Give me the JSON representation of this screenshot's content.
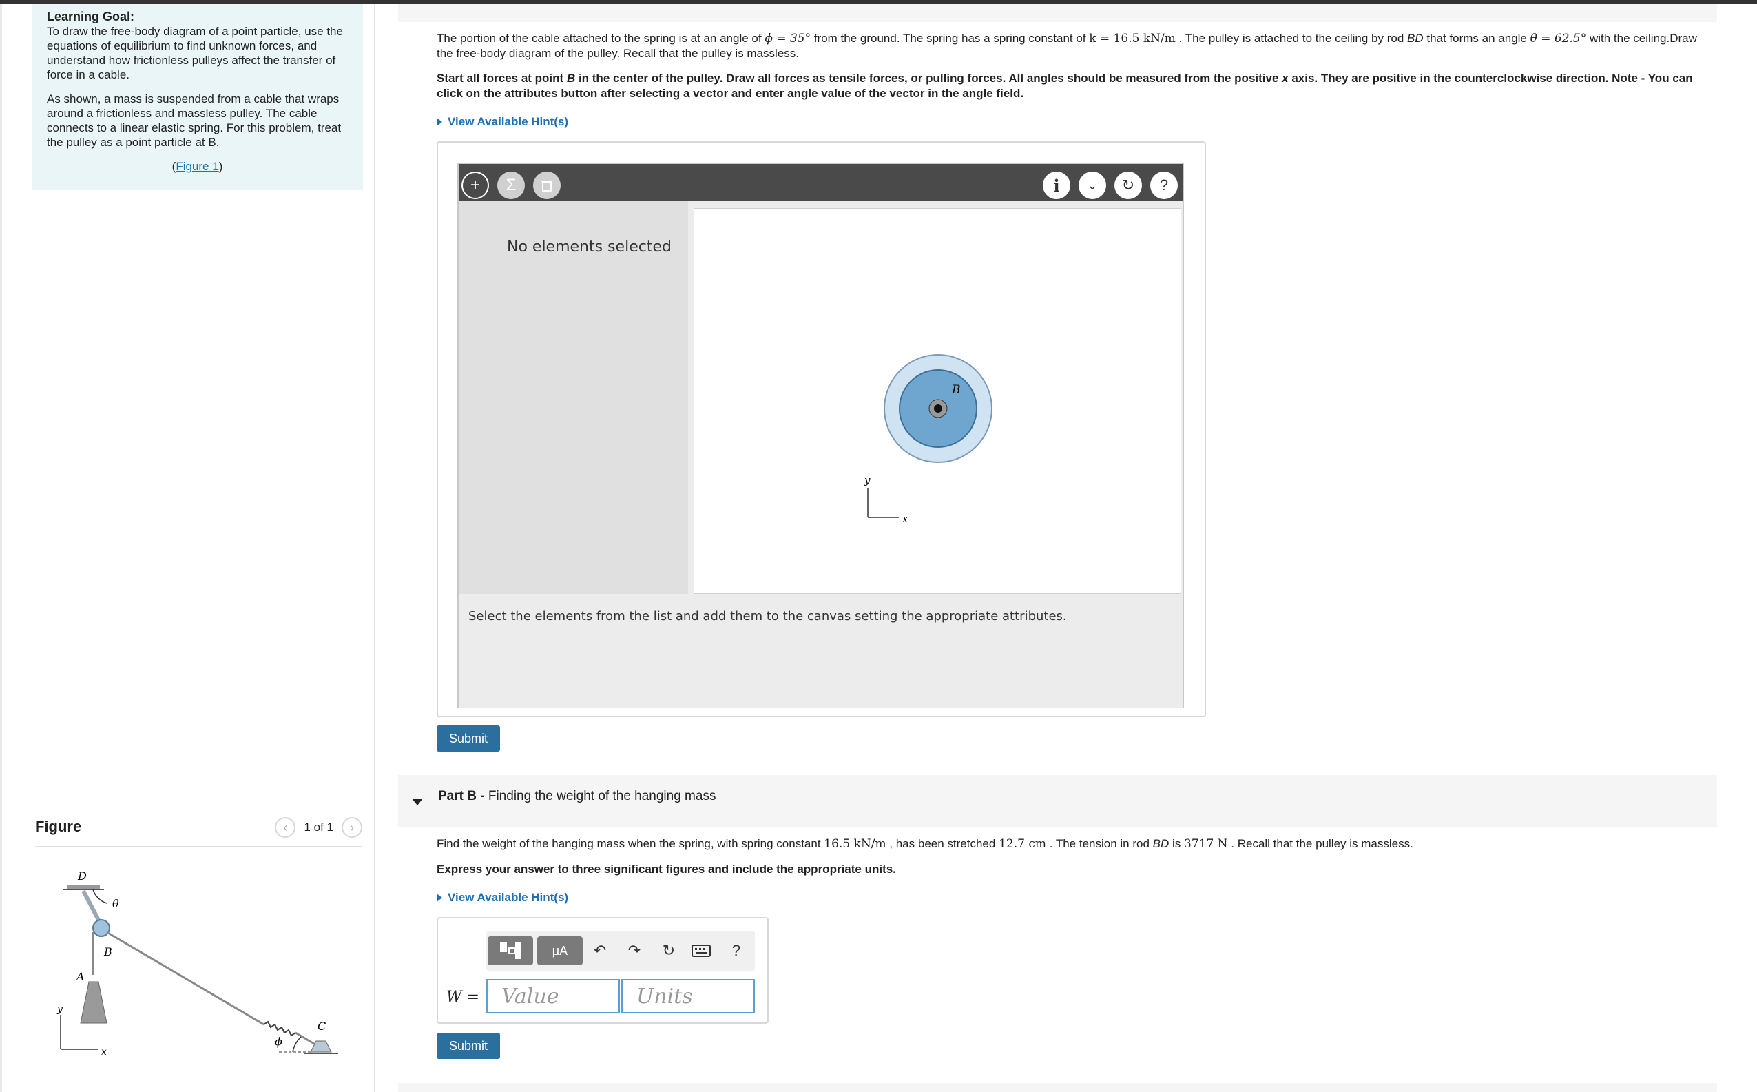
{
  "sidebar": {
    "goal_title": "Learning Goal:",
    "goal_text": "To draw the free-body diagram of a point particle, use the equations of equilibrium to find unknown forces, and understand how frictionless pulleys affect the transfer of force in a cable.",
    "setup_text": "As shown, a mass is suspended from a cable that wraps around a frictionless and massless pulley. The cable connects to a linear elastic spring. For this problem, treat the pulley as a point particle at B.",
    "figure_link": "Figure 1",
    "figure_title": "Figure",
    "figure_counter": "1 of 1",
    "figure_labels": {
      "D": "D",
      "theta": "θ",
      "B": "B",
      "A": "A",
      "y": "y",
      "x": "x",
      "phi": "ϕ",
      "C": "C"
    }
  },
  "part_a": {
    "problem_pre_phi": "The portion of the cable attached to the spring is at an angle of ",
    "phi_expr": "ϕ = 35°",
    "problem_mid_k": " from the ground. The spring has a spring constant of ",
    "k_expr": "k = 16.5 kN/m",
    "problem_mid_theta": " . The pulley is attached to the ceiling by rod ",
    "rod_name": "BD",
    "problem_mid_angle": " that forms an angle ",
    "theta_expr": "θ = 62.5°",
    "problem_end": " with the ceiling.Draw the free-body diagram of the pulley. Recall that the pulley is massless.",
    "instr_pre": "Start all forces at point ",
    "instr_point": "B",
    "instr_mid": " in the center of the pulley. Draw all forces as tensile forces, or pulling forces. All angles should be measured from the positive ",
    "instr_axis": "x",
    "instr_end": " axis. They are positive in the counterclockwise direction. Note - You can click on the attributes button after selecting a vector and enter angle value of the vector in the angle field.",
    "hint_label": "View Available Hint(s)",
    "tool": {
      "add_icon": "plus-icon",
      "sum_icon": "sigma-icon",
      "delete_icon": "trash-icon",
      "info_icon": "info-icon",
      "dropdown_icon": "chevron-down-icon",
      "reset_icon": "reset-icon",
      "help_icon": "help-icon",
      "no_elements": "No elements selected",
      "footer_text": "Select the elements from the list and add them to the canvas setting the appropriate attributes.",
      "pulley_label": "B",
      "axis_y": "y",
      "axis_x": "x"
    },
    "submit_label": "Submit"
  },
  "part_b": {
    "heading_bold": "Part B -",
    "heading_text": " Finding the weight of the hanging mass",
    "problem_pre": "Find the weight of the hanging mass when the spring, with spring constant ",
    "k_value": "16.5 kN/m",
    "problem_mid": " , has been stretched ",
    "stretch_value": "12.7 cm",
    "problem_mid2": " . The tension in rod ",
    "rod_name": "BD",
    "problem_mid3": " is ",
    "tension_value": "3717 N",
    "problem_end": " . Recall that the pulley is massless.",
    "instruction": "Express your answer to three significant figures and include the appropriate units.",
    "hint_label": "View Available Hint(s)",
    "units_tool_label": "μA",
    "help_label": "?",
    "var_label": "W =",
    "value_placeholder": "Value",
    "units_placeholder": "Units",
    "submit_label": "Submit"
  },
  "colors": {
    "accent": "#2b6f9e",
    "link": "#1f6fb2",
    "goal_bg": "#e9f5f7",
    "toolbar": "#4a4a4a",
    "pulley_outer": "#cfe3f2",
    "pulley_inner": "#6fa6cf"
  }
}
